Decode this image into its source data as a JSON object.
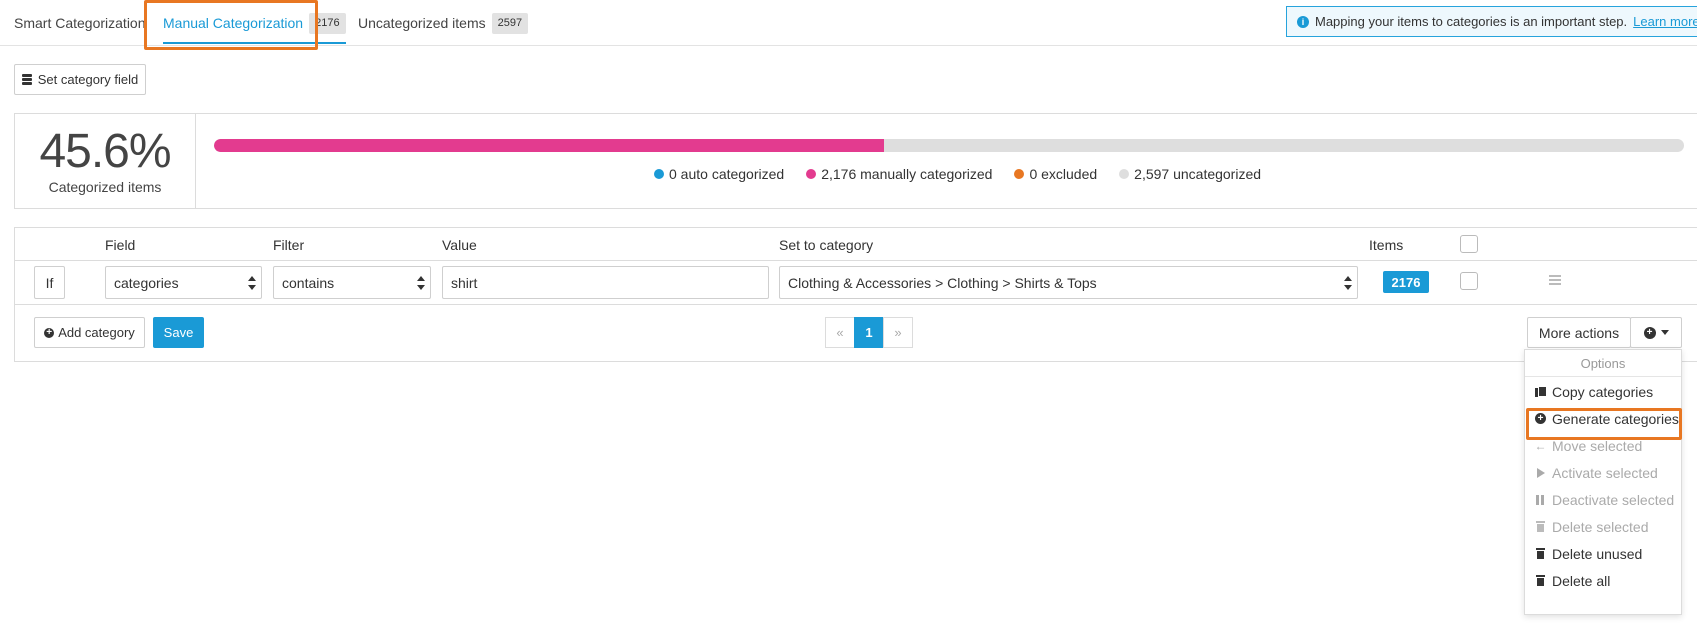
{
  "tabs": {
    "smart": {
      "label": "Smart Categorization"
    },
    "manual": {
      "label": "Manual Categorization",
      "count": "2176"
    },
    "uncategorized": {
      "label": "Uncategorized items",
      "count": "2597"
    }
  },
  "info_banner": {
    "icon": "info-icon",
    "text": "Mapping your items to categories is an important step.",
    "link": "Learn more."
  },
  "toolbar": {
    "set_field_label": "Set category field"
  },
  "summary": {
    "percent": "45.6%",
    "label": "Categorized items",
    "progress_fraction": 0.456,
    "legend": [
      {
        "text": "0 auto categorized",
        "color": "#1a9ad6"
      },
      {
        "text": "2,176 manually categorized",
        "color": "#e33b8f"
      },
      {
        "text": "0 excluded",
        "color": "#e87722"
      },
      {
        "text": "2,597 uncategorized",
        "color": "#dedede"
      }
    ]
  },
  "rules": {
    "headers": {
      "field": "Field",
      "filter": "Filter",
      "value": "Value",
      "category": "Set to category",
      "items": "Items"
    },
    "row": {
      "condition": "If",
      "field": "categories",
      "filter": "contains",
      "value": "shirt",
      "category": "Clothing & Accessories > Clothing > Shirts & Tops",
      "items": "2176"
    },
    "add_category_label": "Add category",
    "save_label": "Save",
    "pagination": {
      "prev": "«",
      "current": "1",
      "next": "»"
    },
    "more_actions_label": "More actions"
  },
  "options_menu": {
    "header": "Options",
    "items": [
      {
        "label": "Copy categories",
        "icon": "copy-icon",
        "enabled": true
      },
      {
        "label": "Generate categories",
        "icon": "plus-circle-icon",
        "enabled": true
      },
      {
        "label": "Move selected",
        "icon": "arrow-left-icon",
        "enabled": false
      },
      {
        "label": "Activate selected",
        "icon": "play-icon",
        "enabled": false
      },
      {
        "label": "Deactivate selected",
        "icon": "pause-icon",
        "enabled": false
      },
      {
        "label": "Delete selected",
        "icon": "trash-icon",
        "enabled": false
      },
      {
        "label": "Delete unused",
        "icon": "trash-icon",
        "enabled": true
      },
      {
        "label": "Delete all",
        "icon": "trash-icon",
        "enabled": true
      }
    ]
  },
  "colors": {
    "accent": "#1a9ad6",
    "highlight": "#e87722",
    "manual": "#e33b8f"
  }
}
